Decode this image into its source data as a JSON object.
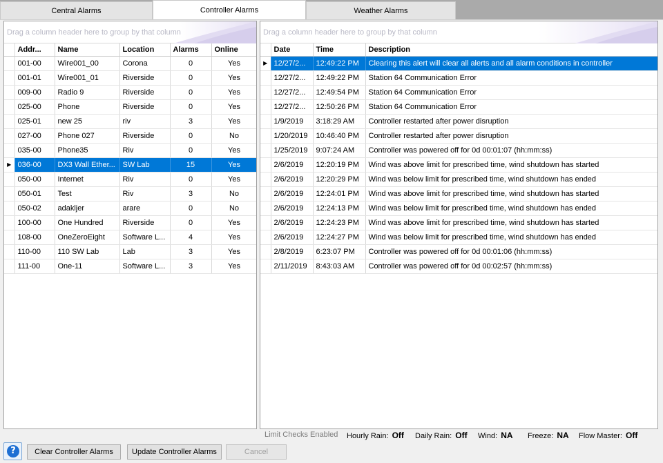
{
  "tabs": [
    "Central Alarms",
    "Controller Alarms",
    "Weather Alarms"
  ],
  "group_panel_hint": "Drag a column header here to group by that column",
  "controllers": {
    "columns": [
      "Addr...",
      "Name",
      "Location",
      "Alarms",
      "Online"
    ],
    "rows": [
      {
        "addr": "001-00",
        "name": "Wire001_00",
        "location": "Corona",
        "alarms": "0",
        "online": "Yes"
      },
      {
        "addr": "001-01",
        "name": "Wire001_01",
        "location": "Riverside",
        "alarms": "0",
        "online": "Yes"
      },
      {
        "addr": "009-00",
        "name": "Radio 9",
        "location": "Riverside",
        "alarms": "0",
        "online": "Yes"
      },
      {
        "addr": "025-00",
        "name": "Phone",
        "location": "Riverside",
        "alarms": "0",
        "online": "Yes"
      },
      {
        "addr": "025-01",
        "name": "new 25",
        "location": "riv",
        "alarms": "3",
        "online": "Yes"
      },
      {
        "addr": "027-00",
        "name": "Phone 027",
        "location": "Riverside",
        "alarms": "0",
        "online": "No"
      },
      {
        "addr": "035-00",
        "name": "Phone35",
        "location": "Riv",
        "alarms": "0",
        "online": "Yes"
      },
      {
        "addr": "036-00",
        "name": "DX3 Wall Ether...",
        "location": "SW Lab",
        "alarms": "15",
        "online": "Yes",
        "selected": true
      },
      {
        "addr": "050-00",
        "name": "Internet",
        "location": "Riv",
        "alarms": "0",
        "online": "Yes"
      },
      {
        "addr": "050-01",
        "name": "Test",
        "location": "Riv",
        "alarms": "3",
        "online": "No"
      },
      {
        "addr": "050-02",
        "name": "adakljer",
        "location": "arare",
        "alarms": "0",
        "online": "No"
      },
      {
        "addr": "100-00",
        "name": "One Hundred",
        "location": "Riverside",
        "alarms": "0",
        "online": "Yes"
      },
      {
        "addr": "108-00",
        "name": "OneZeroEight",
        "location": "Software L...",
        "alarms": "4",
        "online": "Yes"
      },
      {
        "addr": "110-00",
        "name": "110 SW Lab",
        "location": "Lab",
        "alarms": "3",
        "online": "Yes"
      },
      {
        "addr": "111-00",
        "name": "One-11",
        "location": "Software L...",
        "alarms": "3",
        "online": "Yes"
      }
    ]
  },
  "alarms": {
    "columns": [
      "Date",
      "Time",
      "Description"
    ],
    "rows": [
      {
        "date": "12/27/2...",
        "time": "12:49:22 PM",
        "desc": "Clearing this alert will clear all alerts and all alarm conditions in controller",
        "selected": true
      },
      {
        "date": "12/27/2...",
        "time": "12:49:22 PM",
        "desc": "Station 64 Communication Error"
      },
      {
        "date": "12/27/2...",
        "time": "12:49:54 PM",
        "desc": "Station 64 Communication Error"
      },
      {
        "date": "12/27/2...",
        "time": "12:50:26 PM",
        "desc": "Station 64 Communication Error"
      },
      {
        "date": "1/9/2019",
        "time": "3:18:29 AM",
        "desc": "Controller restarted after power disruption"
      },
      {
        "date": "1/20/2019",
        "time": "10:46:40 PM",
        "desc": "Controller restarted after power disruption"
      },
      {
        "date": "1/25/2019",
        "time": "9:07:24 AM",
        "desc": "Controller was powered off for 0d 00:01:07 (hh:mm:ss)"
      },
      {
        "date": "2/6/2019",
        "time": "12:20:19 PM",
        "desc": "Wind was above limit for prescribed time, wind shutdown has started"
      },
      {
        "date": "2/6/2019",
        "time": "12:20:29 PM",
        "desc": "Wind was below limit for prescribed time, wind shutdown has ended"
      },
      {
        "date": "2/6/2019",
        "time": "12:24:01 PM",
        "desc": "Wind was above limit for prescribed time, wind shutdown has started"
      },
      {
        "date": "2/6/2019",
        "time": "12:24:13 PM",
        "desc": "Wind was below limit for prescribed time, wind shutdown has ended"
      },
      {
        "date": "2/6/2019",
        "time": "12:24:23 PM",
        "desc": "Wind was above limit for prescribed time, wind shutdown has started"
      },
      {
        "date": "2/6/2019",
        "time": "12:24:27 PM",
        "desc": "Wind was below limit for prescribed time, wind shutdown has ended"
      },
      {
        "date": "2/8/2019",
        "time": "6:23:07 PM",
        "desc": "Controller was powered off for 0d 00:01:06 (hh:mm:ss)"
      },
      {
        "date": "2/11/2019",
        "time": "8:43:03 AM",
        "desc": "Controller was powered off for 0d 00:02:57 (hh:mm:ss)"
      }
    ]
  },
  "status": {
    "limit_checks": "Limit Checks Enabled",
    "hourly_rain_label": "Hourly Rain:",
    "hourly_rain_value": "Off",
    "daily_rain_label": "Daily Rain:",
    "daily_rain_value": "Off",
    "wind_label": "Wind:",
    "wind_value": "NA",
    "freeze_label": "Freeze:",
    "freeze_value": "NA",
    "flow_master_label": "Flow Master:",
    "flow_master_value": "Off"
  },
  "buttons": {
    "help": "?",
    "clear": "Clear Controller Alarms",
    "update": "Update Controller Alarms",
    "cancel": "Cancel"
  },
  "colors": {
    "selection": "#0078d7",
    "tabbar": "#aaaaaa"
  }
}
